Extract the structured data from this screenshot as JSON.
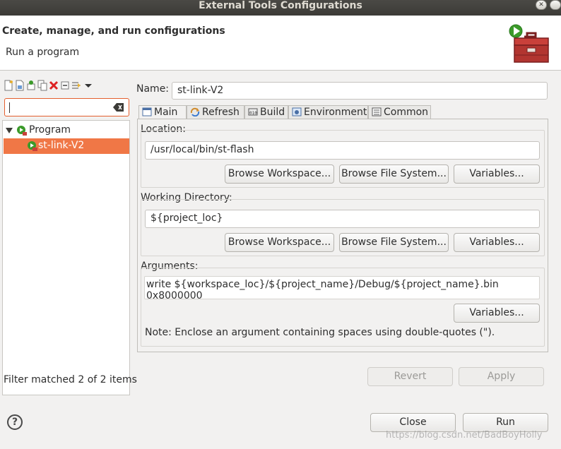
{
  "window": {
    "title": "External Tools Configurations"
  },
  "header": {
    "title": "Create, manage, and run configurations",
    "message": "Run a program"
  },
  "left": {
    "filter": {
      "value": ""
    },
    "tree": [
      {
        "label": "Program",
        "expanded": true
      },
      {
        "label": "st-link-V2",
        "selected": true
      }
    ],
    "status": "Filter matched 2 of 2 items"
  },
  "config": {
    "name_label": "Name:",
    "name_value": "st-link-V2",
    "tabs": [
      {
        "label": "Main",
        "icon": "main-tab-icon",
        "active": true
      },
      {
        "label": "Refresh",
        "icon": "refresh-icon"
      },
      {
        "label": "Build",
        "icon": "build-icon"
      },
      {
        "label": "Environment",
        "icon": "environment-icon"
      },
      {
        "label": "Common",
        "icon": "common-icon"
      }
    ],
    "location": {
      "label": "Location:",
      "value": "/usr/local/bin/st-flash",
      "browse_workspace": "Browse Workspace...",
      "browse_fs": "Browse File System...",
      "variables": "Variables..."
    },
    "workdir": {
      "label": "Working Directory:",
      "value": "${project_loc}",
      "browse_workspace": "Browse Workspace...",
      "browse_fs": "Browse File System...",
      "variables": "Variables..."
    },
    "arguments": {
      "label": "Arguments:",
      "value": "write ${workspace_loc}/${project_name}/Debug/${project_name}.bin 0x8000000",
      "variables": "Variables...",
      "note": "Note: Enclose an argument containing spaces using double-quotes (\")."
    },
    "revert": "Revert",
    "apply": "Apply"
  },
  "footer": {
    "help": "?",
    "close": "Close",
    "run": "Run",
    "watermark": "https://blog.csdn.net/BadBoyHolly"
  },
  "colors": {
    "selection": "#f07746",
    "focus_border": "#e45f2e",
    "titlebar": "#3c3b37"
  }
}
